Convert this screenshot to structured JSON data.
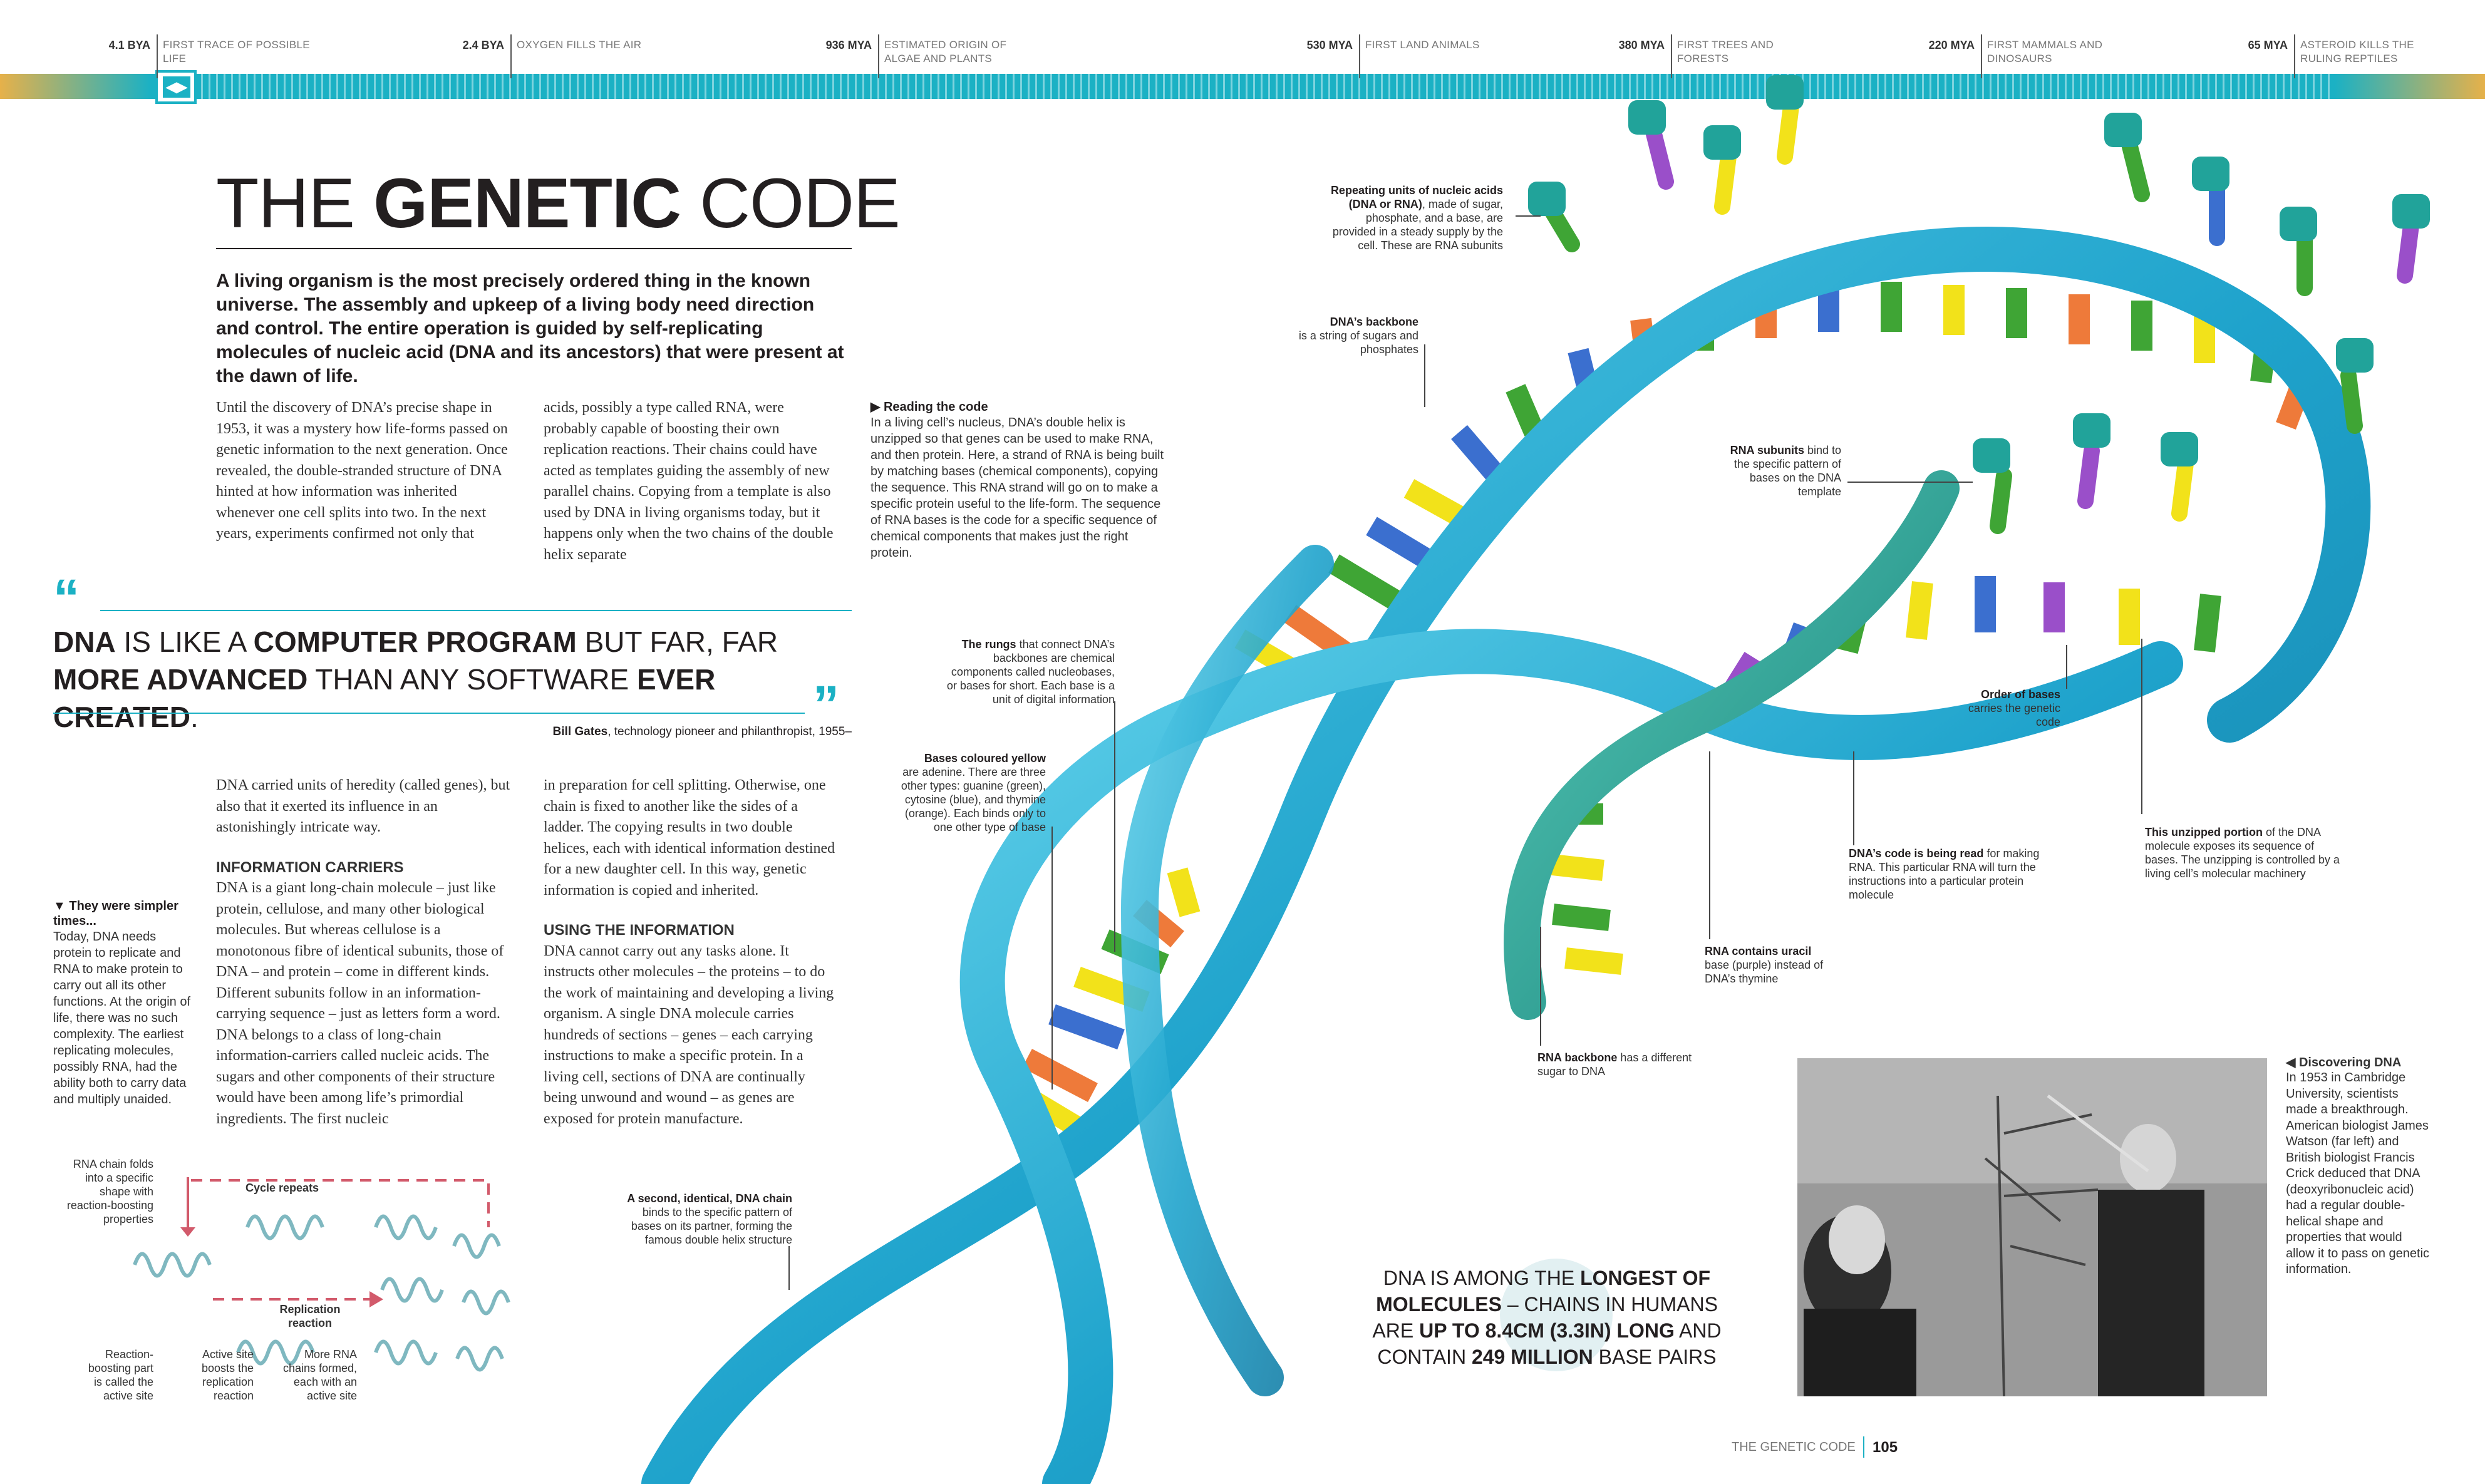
{
  "timeline": {
    "items": [
      {
        "year": "4.1 BYA",
        "label": "FIRST TRACE OF POSSIBLE LIFE"
      },
      {
        "year": "2.4 BYA",
        "label": "OXYGEN FILLS THE AIR"
      },
      {
        "year": "936 MYA",
        "label": "ESTIMATED ORIGIN OF ALGAE AND PLANTS"
      },
      {
        "year": "530 MYA",
        "label": "FIRST LAND ANIMALS"
      },
      {
        "year": "380 MYA",
        "label": "FIRST TREES AND FORESTS"
      },
      {
        "year": "220 MYA",
        "label": "FIRST MAMMALS AND DINOSAURS"
      },
      {
        "year": "65 MYA",
        "label": "ASTEROID KILLS THE RULING REPTILES"
      }
    ],
    "marker_glyph": "◀▶"
  },
  "headline": {
    "light_1": "THE ",
    "bold": "GENETIC",
    "light_2": " CODE"
  },
  "intro": "A living organism is the most precisely ordered thing in the known universe. The assembly and upkeep of a living body need direction and control. The entire operation is guided by self-replicating molecules of nucleic acid (DNA and its ancestors) that were present at the dawn of life.",
  "body": {
    "col1_top": "Until the discovery of DNA’s precise shape in 1953, it was a mystery how life-forms passed on genetic information to the next generation. Once revealed, the double-stranded structure of DNA hinted at how information was inherited whenever one cell splits into two. In the next years, experiments confirmed not only that",
    "col2_top": "acids, possibly a type called RNA, were probably capable of boosting their own replication reactions. Their chains could have acted as templates guiding the assembly of new parallel chains. Copying from a template is also used by DNA in living organisms today, but it happens only when the two chains of the double helix separate",
    "col1_bottom_a": "DNA carried units of heredity (called genes), but also that it exerted its influence in an astonishingly intricate way.",
    "heading_info": "INFORMATION CARRIERS",
    "col1_bottom_b": "DNA is a giant long-chain molecule – just like protein, cellulose, and many other biological molecules. But whereas cellulose is a monotonous fibre of identical subunits, those of DNA – and protein – come in different kinds. Different subunits follow in an information-carrying sequence – just as letters form a word. DNA belongs to a class of long-chain information-carriers called nucleic acids. The sugars and other components of their structure would have been among life’s primordial ingredients. The first nucleic",
    "col2_bottom_a": "in preparation for cell splitting. Otherwise, one chain is fixed to another like the sides of a ladder. The copying results in two double helices, each with identical information destined for a new daughter cell. In this way, genetic information is copied and inherited.",
    "heading_using": "USING THE INFORMATION",
    "col2_bottom_b": "DNA cannot carry out any tasks alone. It instructs other molecules – the proteins – to do the work of maintaining and developing a living organism. A single DNA molecule carries hundreds of sections – genes – each carrying instructions to make a specific protein. In a living cell, sections of DNA are continually being unwound and wound – as genes are exposed for protein manufacture."
  },
  "quote": {
    "open_mark": "“",
    "close_mark": "”",
    "b1": "DNA",
    "t1": " IS LIKE A ",
    "b2": "COMPUTER PROGRAM",
    "t2": " BUT FAR, FAR ",
    "b3": "MORE ADVANCED",
    "t3": " THAN ANY SOFTWARE ",
    "b4": "EVER CREATED",
    "t4": ".",
    "attribution_name": "Bill Gates",
    "attribution_role": ", technology pioneer and philanthropist, 1955–"
  },
  "sidebar": {
    "heading": "▼ They were simpler times...",
    "text": "Today, DNA needs protein to replicate and RNA to make protein to carry out all its other functions. At the origin of life, there was no such complexity. The earliest replicating molecules, possibly RNA, had the ability both to carry data and multiply unaided."
  },
  "reading": {
    "heading": "▶ Reading the code",
    "text": "In a living cell’s nucleus, DNA’s double helix is unzipped so that genes can be used to make RNA, and then protein. Here, a strand of RNA is being built by matching bases (chemical components), copying the sequence. This RNA strand will go on to make a specific protein useful to the life-form. The sequence of RNA bases is the code for a specific sequence of chemical components that makes just the right protein."
  },
  "diagram": {
    "chain_label": "RNA chain folds into a specific shape with reaction-boosting properties",
    "cycle": "Cycle repeats",
    "replication": "Replication reaction",
    "boost": "Reaction-boosting part is called the active site",
    "active": "Active site boosts the replication reaction",
    "more": "More RNA chains formed, each with an active site"
  },
  "annotations": {
    "repeating_b": "Repeating units of nucleic acids (DNA or RNA)",
    "repeating_t": ", made of sugar, phosphate, and a base, are provided in a steady supply by the cell. These are RNA subunits",
    "backbone_b": "DNA’s backbone",
    "backbone_t": "is a string of sugars and phosphates",
    "rna_subunits_b": "RNA subunits",
    "rna_subunits_t": " bind to the specific pattern of bases on the DNA template",
    "rungs_b": "The rungs",
    "rungs_t": " that connect DNA’s backbones are chemical components called nucleobases, or bases for short. Each base is a unit of digital information",
    "yellow_b": "Bases coloured yellow",
    "yellow_t": "are adenine. There are three other types: guanine (green), cytosine (blue), and thymine (orange). Each binds only to one other type of base",
    "order_b": "Order of bases",
    "order_t": "carries the genetic code",
    "unzipped_b": "This unzipped portion",
    "unzipped_t": " of the DNA molecule exposes its sequence of bases. The unzipping is controlled by a living cell’s molecular machinery",
    "being_read_b": "DNA’s code is being read",
    "being_read_t": " for making RNA. This particular RNA will turn the instructions into a particular protein molecule",
    "uracil_b": "RNA contains uracil",
    "uracil_t": "base (purple) instead of DNA’s thymine",
    "rna_backbone_b": "RNA backbone",
    "rna_backbone_t": " has a different sugar to DNA",
    "second_b": "A second, identical, DNA chain",
    "second_t": " binds to the specific pattern of bases on its partner, forming the famous double helix structure"
  },
  "callout": {
    "t1": "DNA IS AMONG THE ",
    "b1": "LONGEST OF MOLECULES",
    "t2": " – CHAINS IN HUMANS ARE ",
    "b2": "UP TO 8.4CM (3.3IN) LONG",
    "t3": " AND CONTAIN ",
    "b3": "249 MILLION",
    "t4": " BASE PAIRS"
  },
  "caption": {
    "heading": "◀ Discovering DNA",
    "text": "In 1953 in Cambridge University, scientists made a breakthrough. American biologist James Watson (far left) and British biologist Francis Crick deduced that DNA (deoxyribonucleic acid) had a regular double-helical shape and properties that would allow it to pass on genetic information."
  },
  "footer": {
    "running_head": "THE GENETIC CODE",
    "page": "105"
  },
  "colors": {
    "accent": "#1bb1c4",
    "helix": "#1fa3cc",
    "rna": "#21a39a",
    "adenine": "#f2e21a",
    "guanine": "#3fa535",
    "cytosine": "#3b6fcf",
    "thymine": "#ee7a3a",
    "uracil": "#9a4fc9"
  }
}
